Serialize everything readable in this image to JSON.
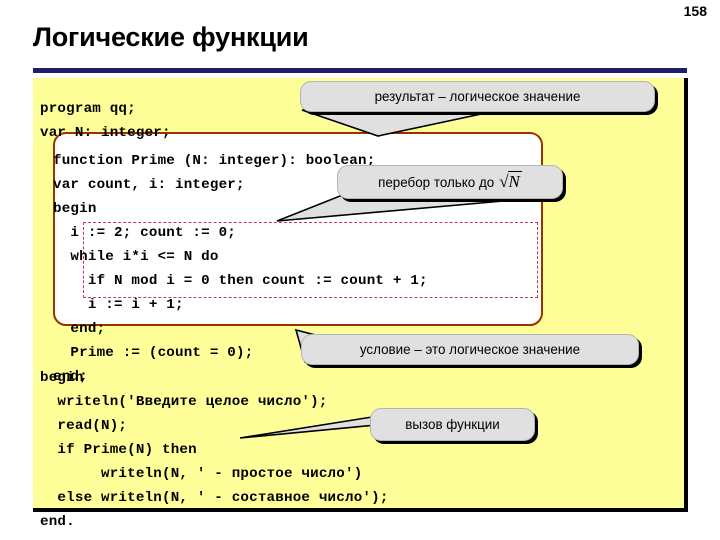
{
  "slide": {
    "page_number": "158",
    "title": "Логические функции",
    "rule_color": "#1f1f63",
    "panel_color": "#ffff99"
  },
  "code": {
    "header": "program qq;\nvar N: integer;",
    "function_body": "function Prime (N: integer): boolean;\nvar count, i: integer;\nbegin\n  i := 2; count := 0;\n  while i*i <= N do\n    if N mod i = 0 then count := count + 1;\n    i := i + 1;\n  end;\n  Prime := (count = 0);\nend;",
    "main_body": "begin\n  writeln('Введите целое число');\n  read(N);\n  if Prime(N) then\n       writeln(N, ' - простое число')\n  else writeln(N, ' - составное число');\nend."
  },
  "callouts": {
    "result": "результат – логическое значение",
    "sqrt_prefix": "перебор только до",
    "sqrt_symbol": "√",
    "sqrt_radicand": "N",
    "condition": "условие – это логическое значение",
    "call": "вызов функции"
  },
  "colors": {
    "func_border": "#993300",
    "loop_border": "#cc3355",
    "callout_bg": "#e0e0e0",
    "shadow": "#000000"
  }
}
